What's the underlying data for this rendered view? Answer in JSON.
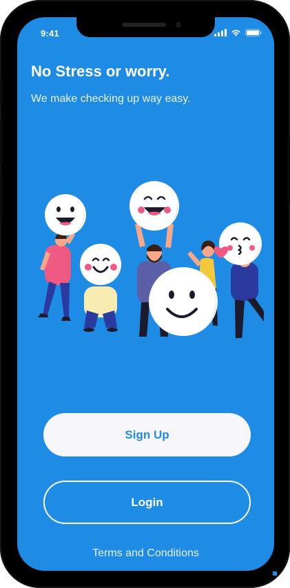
{
  "status_bar": {
    "time": "9:41",
    "icons": [
      "signal-icon",
      "wifi-icon",
      "battery-icon"
    ]
  },
  "onboarding": {
    "headline": "No Stress or worry.",
    "subheadline": "We make checking up way easy.",
    "illustration": "group-of-people-holding-smiley-faces"
  },
  "actions": {
    "signup_label": "Sign Up",
    "login_label": "Login",
    "terms_label": "Terms and Conditions"
  },
  "colors": {
    "background": "#1e8be4",
    "primary_text": "#ffffff",
    "signup_button": "#f7f7fb",
    "signup_text": "#1e8be4"
  }
}
